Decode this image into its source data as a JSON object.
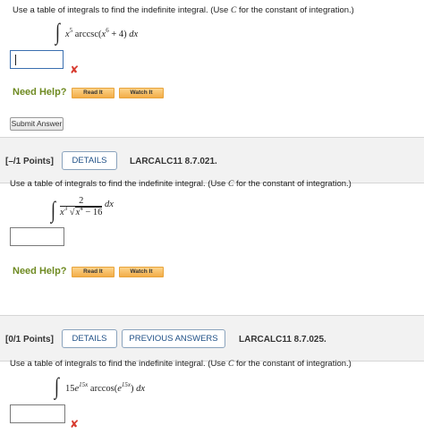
{
  "problems": [
    {
      "prompt_pre": "Use a table of integrals to find the indefinite integral. (Use ",
      "prompt_var": "C",
      "prompt_post": " for the constant of integration.)",
      "integral_symbol": "∫",
      "answer_value": "",
      "has_error": true,
      "help": {
        "label": "Need Help?",
        "read": "Read It",
        "watch": "Watch It"
      },
      "submit_label": "Submit Answer"
    },
    {
      "points": "[–/1 Points]",
      "details_label": "DETAILS",
      "code": "LARCALC11 8.7.021.",
      "prompt_pre": "Use a table of integrals to find the indefinite integral. (Use ",
      "prompt_var": "C",
      "prompt_post": " for the constant of integration.)",
      "integral_symbol": "∫",
      "answer_value": "",
      "has_error": false,
      "help": {
        "label": "Need Help?",
        "read": "Read It",
        "watch": "Watch It"
      }
    },
    {
      "points": "[0/1 Points]",
      "details_label": "DETAILS",
      "previous_label": "PREVIOUS ANSWERS",
      "code": "LARCALC11 8.7.025.",
      "prompt_pre": "Use a table of integrals to find the indefinite integral. (Use ",
      "prompt_var": "C",
      "prompt_post": " for the constant of integration.)",
      "integral_symbol": "∫",
      "answer_value": "",
      "has_error": true
    }
  ],
  "expressions": {
    "p1": {
      "x": "x",
      "exp5": "5",
      "fn": " arccsc(",
      "exp6": "6",
      "tail": " + 4) ",
      "d": "dx"
    },
    "p2": {
      "num": "2",
      "x": "x",
      "exp3": "3",
      "x2": "x",
      "exp4": "4",
      "minus": " − 16",
      "d": "dx"
    },
    "p3": {
      "coef": "15",
      "e": "e",
      "exp1": "15x",
      "fn": " arccos(",
      "e2": "e",
      "exp2": "15x",
      "tail": ") ",
      "d": "dx"
    }
  },
  "icons": {
    "error": "x-mark-icon"
  },
  "colors": {
    "error": "#d73a2e",
    "need_help": "#6e8a21",
    "link_blue": "#1e4f86",
    "button_orange": "#f3ad48"
  }
}
